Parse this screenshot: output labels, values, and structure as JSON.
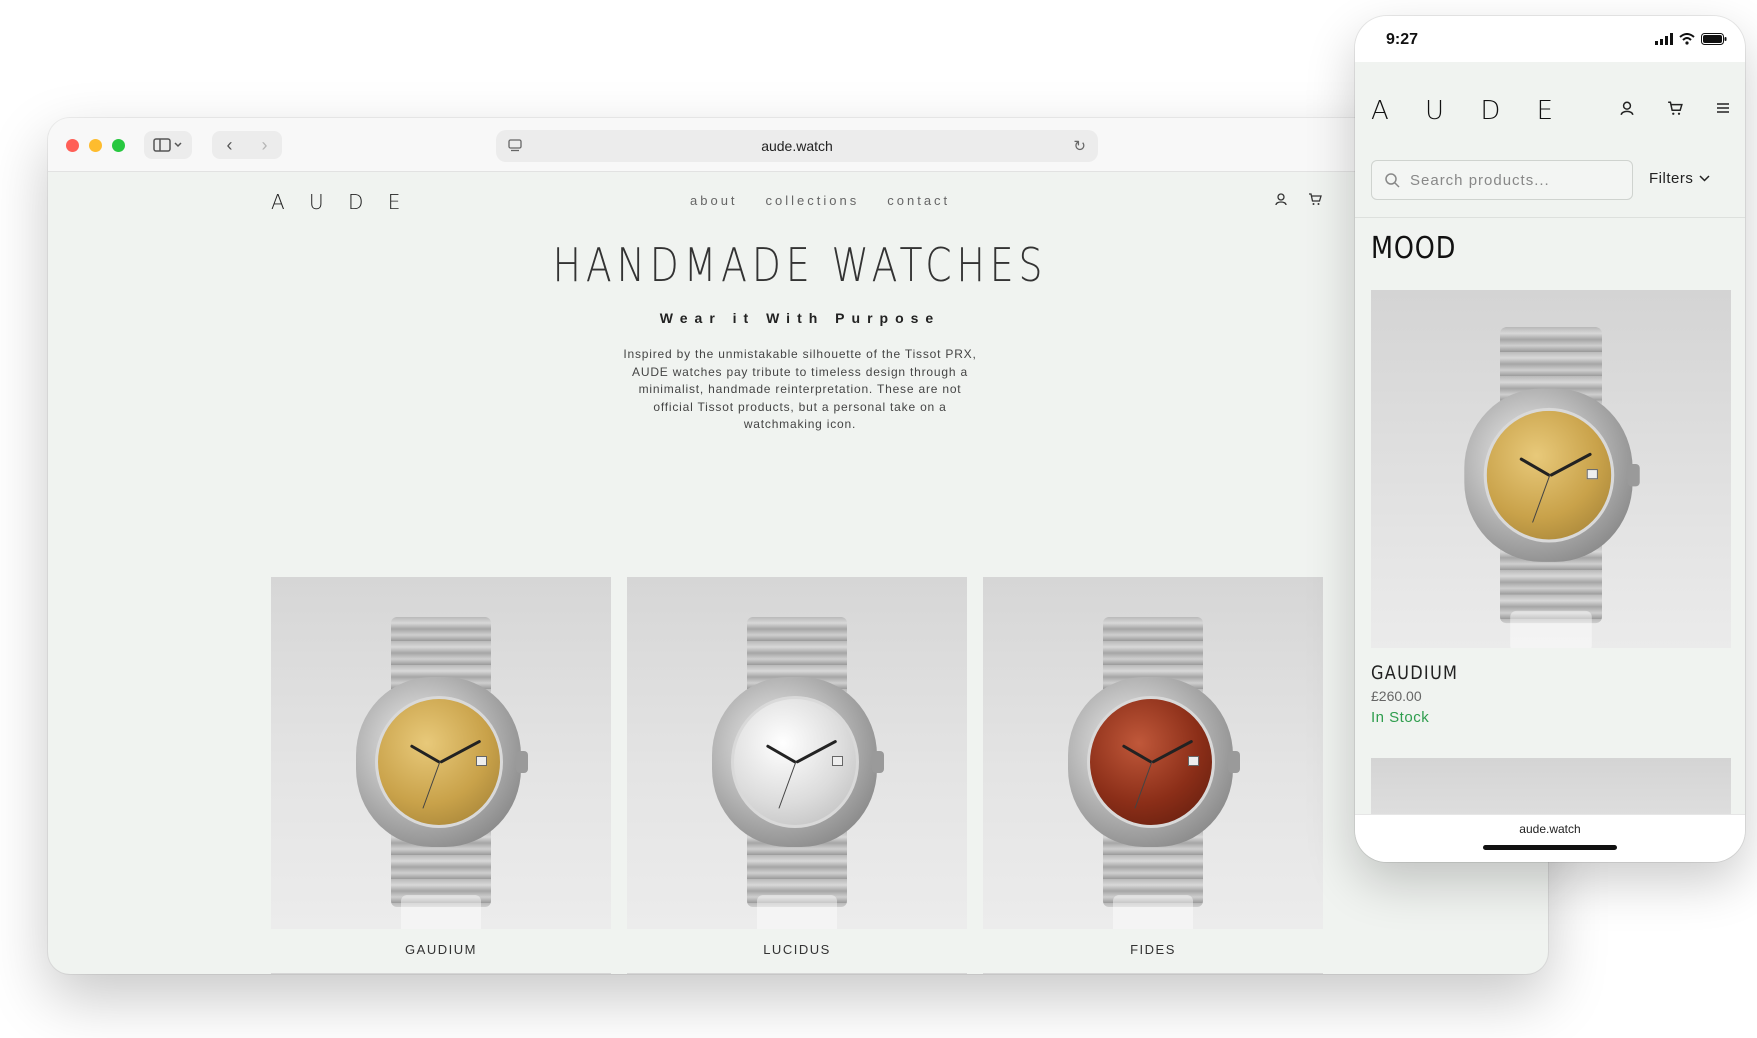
{
  "browser": {
    "url": "aude.watch"
  },
  "site": {
    "logo": "A U D E",
    "nav": [
      {
        "label": "about"
      },
      {
        "label": "collections"
      },
      {
        "label": "contact"
      }
    ],
    "icons": [
      "account-icon",
      "cart-icon"
    ]
  },
  "hero": {
    "title": "HANDMADE WATCHES",
    "subtitle": "Wear it With Purpose",
    "description": "Inspired by the unmistakable silhouette of the Tissot PRX, AUDE watches pay tribute to timeless design through a minimalist, handmade reinterpretation. These are not official Tissot products, but a personal take on a watchmaking icon."
  },
  "products": [
    {
      "name": "GAUDIUM",
      "dial_color": "#c9a24a"
    },
    {
      "name": "LUCIDUS",
      "dial_color": "#dcdcdc"
    },
    {
      "name": "FIDES",
      "dial_color": "#8b2e18"
    }
  ],
  "phone": {
    "time": "9:27",
    "logo": "A U D E",
    "search": {
      "placeholder": "Search products..."
    },
    "filters_label": "Filters",
    "collection_title": "MOOD",
    "product": {
      "name": "GAUDIUM",
      "price": "£260.00",
      "stock": "In Stock",
      "dial_color": "#c9a24a"
    },
    "url": "aude.watch"
  },
  "colors": {
    "background": "#f0f3f0",
    "accent_stock": "#2e9d4d"
  }
}
